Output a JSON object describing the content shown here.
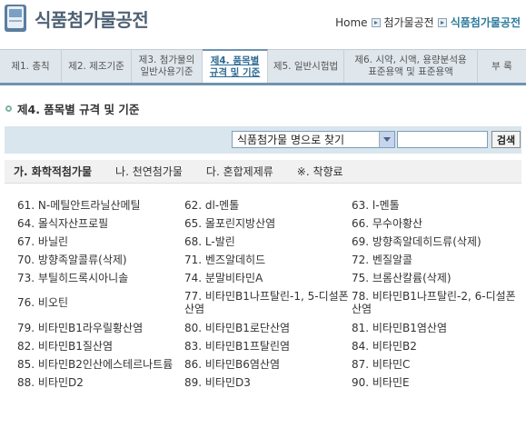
{
  "header": {
    "title": "식품첨가물공전",
    "breadcrumb": {
      "home": "Home",
      "level1": "첨가물공전",
      "current": "식품첨가물공전"
    }
  },
  "tabs": [
    {
      "line1": "제1. 총칙",
      "line2": ""
    },
    {
      "line1": "제2. 제조기준",
      "line2": ""
    },
    {
      "line1": "제3. 첨가물의",
      "line2": "일반사용기준"
    },
    {
      "line1": "제4. 품목별",
      "line2": "규격 및 기준"
    },
    {
      "line1": "제5. 일반시험법",
      "line2": ""
    },
    {
      "line1": "제6. 시약, 시액, 용량분석용",
      "line2": "표준용액 및 표준용액"
    },
    {
      "line1": "부 록",
      "line2": ""
    }
  ],
  "section_title": "제4. 품목별 규격 및 기준",
  "search": {
    "select_value": "식품첨가물 명으로 찾기",
    "input_value": "",
    "button": "검색"
  },
  "categories": [
    "가. 화학적첨가물",
    "나. 천연첨가물",
    "다. 혼합제제류",
    "※. 착향료"
  ],
  "items": [
    [
      "61. N-메틸안트라닐산메틸",
      "62. dl-멘톨",
      "63. l-멘톨"
    ],
    [
      "64. 몰식자산프로필",
      "65. 몰포린지방산염",
      "66. 무수아황산"
    ],
    [
      "67. 바닐린",
      "68. L-발린",
      "69. 방향족알데히드류(삭제)"
    ],
    [
      "70. 방향족알콜류(삭제)",
      "71. 벤즈알데히드",
      "72. 벤질알콜"
    ],
    [
      "73. 부틸히드록시아니솔",
      "74. 분말비타민A",
      "75. 브롬산칼륨(삭제)"
    ],
    [
      "76. 비오틴",
      "77. 비타민B1나프탈린-1, 5-디설폰산염",
      "78. 비타민B1나프탈린-2, 6-디설폰산염"
    ],
    [
      "79. 비타민B1라우릴황산염",
      "80. 비타민B1로단산염",
      "81. 비타민B1염산염"
    ],
    [
      "82. 비타민B1질산염",
      "83. 비타민B1프탈린염",
      "84. 비타민B2"
    ],
    [
      "85. 비타민B2인산에스테르나트륨",
      "86. 비타민B6염산염",
      "87. 비타민C"
    ],
    [
      "88. 비타민D2",
      "89. 비타민D3",
      "90. 비타민E"
    ]
  ]
}
